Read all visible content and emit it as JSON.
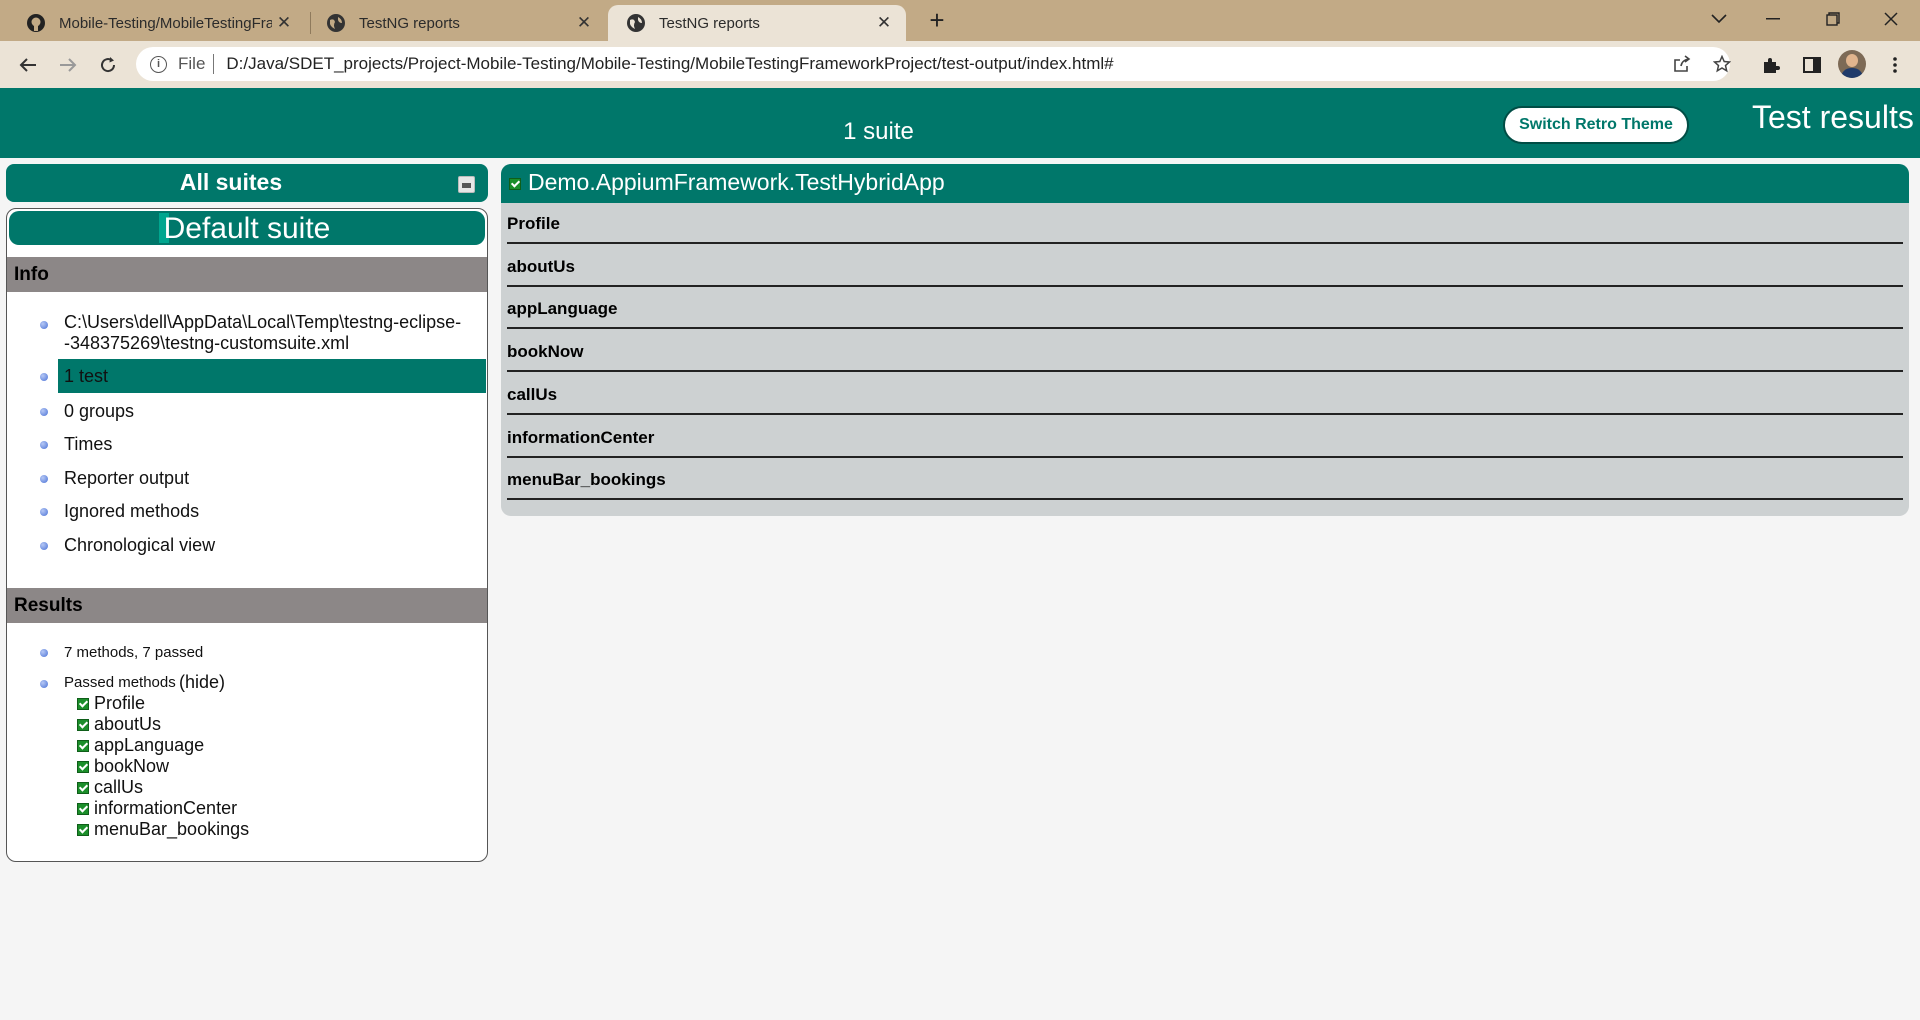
{
  "browser": {
    "tabs": [
      {
        "title": "Mobile-Testing/MobileTestingFra",
        "icon": "github-icon",
        "active": false
      },
      {
        "title": "TestNG reports",
        "icon": "globe-icon",
        "active": false
      },
      {
        "title": "TestNG reports",
        "icon": "globe-icon",
        "active": true
      }
    ],
    "address": {
      "scheme": "File",
      "url": "D:/Java/SDET_projects/Project-Mobile-Testing/Mobile-Testing/MobileTestingFrameworkProject/test-output/index.html#"
    },
    "colors": {
      "tabstrip": "#c2aa86",
      "toolbar": "#ebe3d6"
    }
  },
  "page": {
    "banner": {
      "suite_count": "1 suite",
      "retro_button": "Switch Retro Theme",
      "title": "Test results"
    },
    "sidebar": {
      "all_suites_label": "All suites",
      "suite_name": "Default suite",
      "info_heading": "Info",
      "info_items": [
        "C:\\Users\\dell\\AppData\\Local\\Temp\\testng-eclipse-",
        "-348375269\\testng-customsuite.xml",
        "1 test",
        "0 groups",
        "Times",
        "Reporter output",
        "Ignored methods",
        "Chronological view"
      ],
      "results_heading": "Results",
      "methods_summary": "7 methods, 7 passed",
      "passed_label": "Passed methods",
      "hide_link": "(hide)",
      "passed_methods": [
        "Profile",
        "aboutUs",
        "appLanguage",
        "bookNow",
        "callUs",
        "informationCenter",
        "menuBar_bookings"
      ]
    },
    "main": {
      "class_name": "Demo.AppiumFramework.TestHybridApp",
      "methods": [
        "Profile",
        "aboutUs",
        "appLanguage",
        "bookNow",
        "callUs",
        "informationCenter",
        "menuBar_bookings"
      ]
    },
    "colors": {
      "primary": "#00776a",
      "section_head": "#8c8787",
      "methods_panel": "#cdd1d2",
      "pass_check": "#1b8e2a"
    }
  }
}
